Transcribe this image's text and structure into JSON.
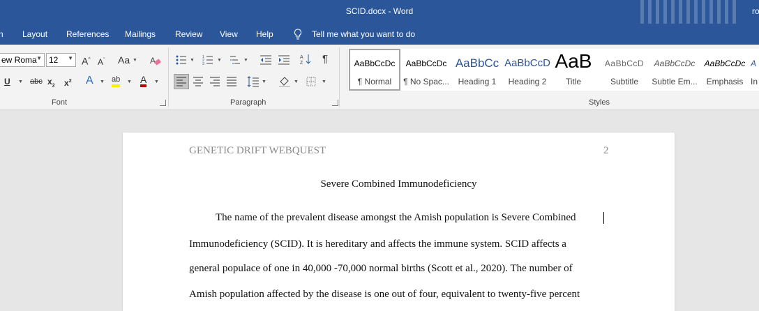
{
  "window": {
    "title": "SCID.docx  -  Word",
    "user_partial": "ro"
  },
  "menu": {
    "items": [
      "n",
      "Layout",
      "References",
      "Mailings",
      "Review",
      "View",
      "Help"
    ],
    "tell_me": "Tell me what you want to do"
  },
  "font_group": {
    "font_name": "ew Roma",
    "font_size": "12",
    "label": "Font"
  },
  "paragraph_group": {
    "label": "Paragraph"
  },
  "styles_group": {
    "label": "Styles",
    "styles": [
      {
        "preview": "AaBbCcDc",
        "name": "¶ Normal"
      },
      {
        "preview": "AaBbCcDc",
        "name": "¶ No Spac..."
      },
      {
        "preview": "AaBbCc",
        "name": "Heading 1"
      },
      {
        "preview": "AaBbCcD",
        "name": "Heading 2"
      },
      {
        "preview": "AaB",
        "name": "Title"
      },
      {
        "preview": "AaBbCcD",
        "name": "Subtitle"
      },
      {
        "preview": "AaBbCcDc",
        "name": "Subtle Em..."
      },
      {
        "preview": "AaBbCcDc",
        "name": "Emphasis"
      },
      {
        "preview": "A",
        "name": "In"
      }
    ]
  },
  "document": {
    "running_head": "GENETIC DRIFT WEBQUEST",
    "page_number": "2",
    "title": "Severe Combined Immunodeficiency",
    "lines": [
      "The name of the prevalent disease amongst the Amish population is Severe Combined",
      "Immunodeficiency (SCID). It is hereditary and affects the immune system. SCID affects a",
      "general populace of one in 40,000 -70,000 normal births (Scott et al., 2020). The number of",
      "Amish population affected by the disease is one out of four, equivalent to twenty-five percent"
    ]
  }
}
